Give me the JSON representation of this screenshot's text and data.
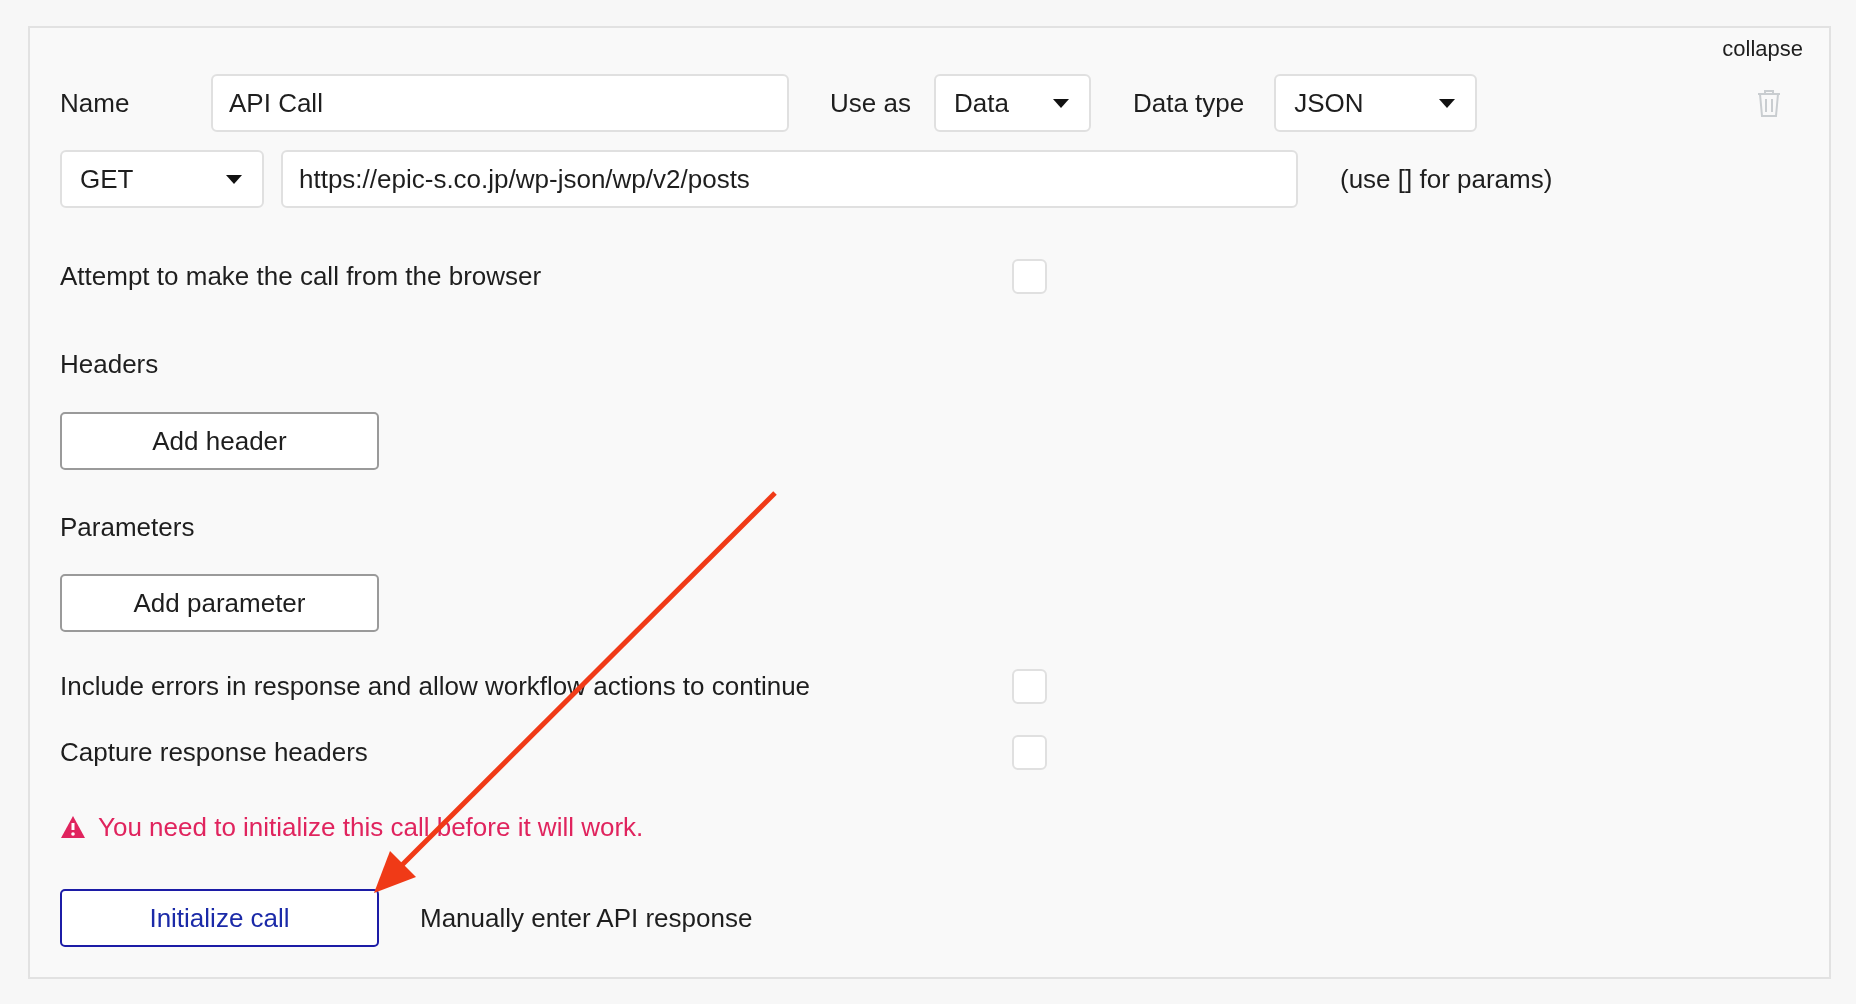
{
  "collapse_link": "collapse",
  "name": {
    "label": "Name",
    "value": "API Call"
  },
  "use_as": {
    "label": "Use as",
    "value": "Data"
  },
  "data_type": {
    "label": "Data type",
    "value": "JSON"
  },
  "method": {
    "value": "GET"
  },
  "url": {
    "value": "https://epic-s.co.jp/wp-json/wp/v2/posts",
    "hint": "(use [] for params)"
  },
  "browser_option": {
    "label": "Attempt to make the call from the browser",
    "checked": false
  },
  "headers": {
    "label": "Headers",
    "button": "Add header"
  },
  "parameters": {
    "label": "Parameters",
    "button": "Add parameter"
  },
  "options": [
    {
      "label": "Include errors in response and allow workflow actions to continue",
      "checked": false
    },
    {
      "label": "Capture response headers",
      "checked": false
    }
  ],
  "warning": "You need to initialize this call before it will work.",
  "initialize_button": "Initialize call",
  "manual_link": "Manually enter API response"
}
